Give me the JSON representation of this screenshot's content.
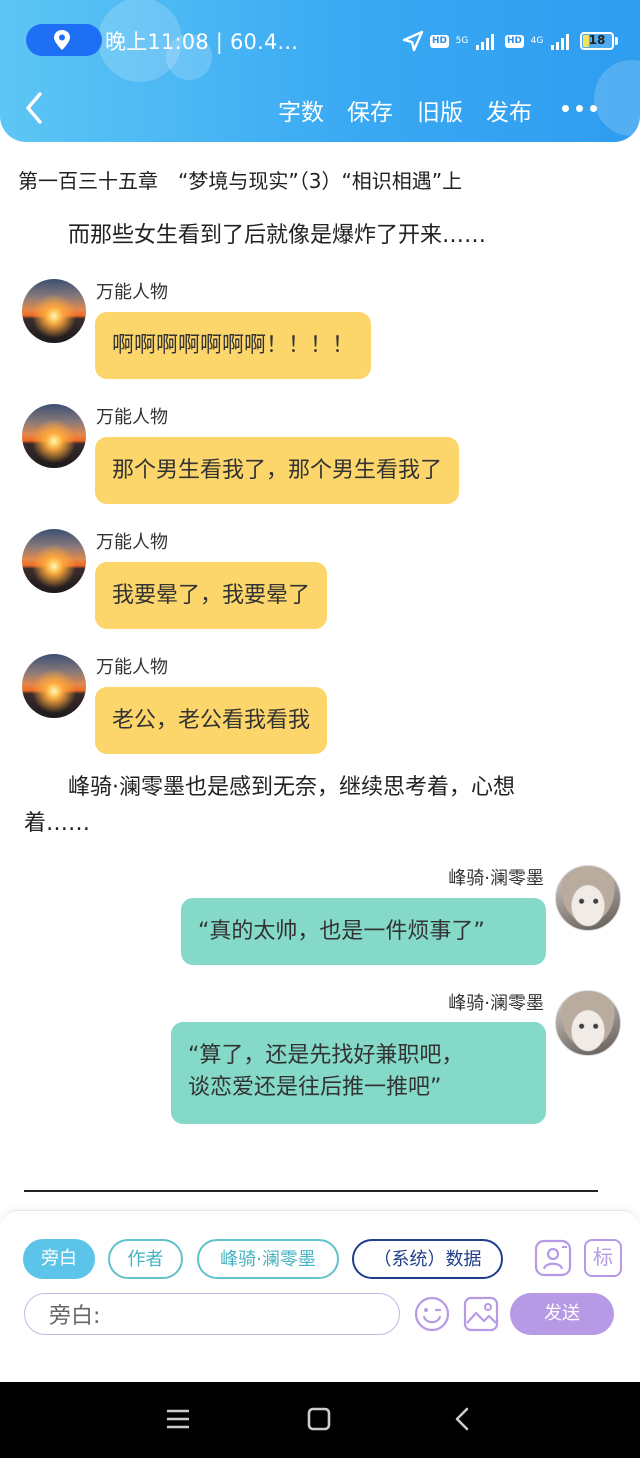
{
  "status_bar": {
    "time": "晚上11:08 | 60.4...",
    "network_5g": "5G",
    "network_4g": "4G",
    "hd": "HD",
    "battery": "18"
  },
  "nav": {
    "word_count": "字数",
    "save": "保存",
    "old_version": "旧版",
    "publish": "发布"
  },
  "chapter_title": "第一百三十五章　“梦境与现实”（3）“相识相遇”上",
  "narration_1": "　　而那些女生看到了后就像是爆炸了开来……",
  "messages_left": [
    {
      "sender": "万能人物",
      "text": "啊啊啊啊啊啊啊！！！！"
    },
    {
      "sender": "万能人物",
      "text": "那个男生看我了，那个男生看我了"
    },
    {
      "sender": "万能人物",
      "text": "我要晕了，我要晕了"
    },
    {
      "sender": "万能人物",
      "text": "老公，老公看我看我"
    }
  ],
  "narration_2_line1": "　　峰骑·澜零墨也是感到无奈，继续思考着，心想",
  "narration_2_line2": "着……",
  "messages_right": [
    {
      "sender": "峰骑·澜零墨",
      "line1": "“真的太帅，也是一件烦事了”",
      "line2": ""
    },
    {
      "sender": "峰骑·澜零墨",
      "line1": "“算了，还是先找好兼职吧，",
      "line2": "谈恋爱还是往后推一推吧”"
    }
  ],
  "roles": {
    "narrator": "旁白",
    "author": "作者",
    "character": "峰骑·澜零墨",
    "system": "（系统）数据"
  },
  "role_icon_label": "标",
  "input": {
    "value": "旁白:"
  },
  "send": "发送",
  "colors": {
    "header": "#3aa9f3",
    "bubble_left": "#fcd66b",
    "bubble_right": "#84d9c8",
    "send_button": "#b79ae6",
    "active_chip": "#5cc4e9"
  }
}
